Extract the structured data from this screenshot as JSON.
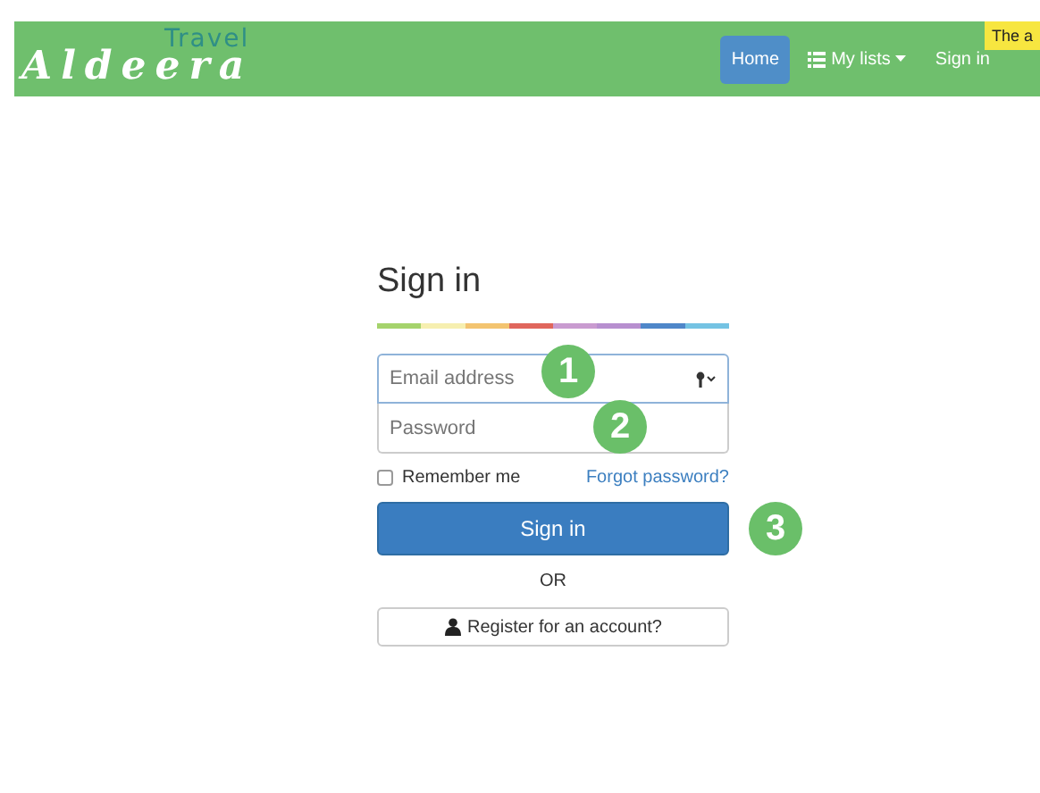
{
  "navbar": {
    "logo": {
      "name": "Aldeera",
      "tagline": "Travel"
    },
    "items": [
      {
        "label": "Home",
        "selected": true,
        "kind": "link"
      },
      {
        "label": "My lists",
        "selected": false,
        "kind": "dropdown"
      },
      {
        "label": "Sign in",
        "selected": false,
        "kind": "link"
      }
    ],
    "tooltip": "The a"
  },
  "form": {
    "title": "Sign in",
    "email": {
      "placeholder": "Email address"
    },
    "password": {
      "placeholder": "Password"
    },
    "remember": {
      "label": "Remember me",
      "checked": false
    },
    "forgot_link": "Forgot password?",
    "submit": "Sign in",
    "separator": "OR",
    "register": "Register for an account?"
  },
  "callouts": [
    "1",
    "2",
    "3"
  ]
}
